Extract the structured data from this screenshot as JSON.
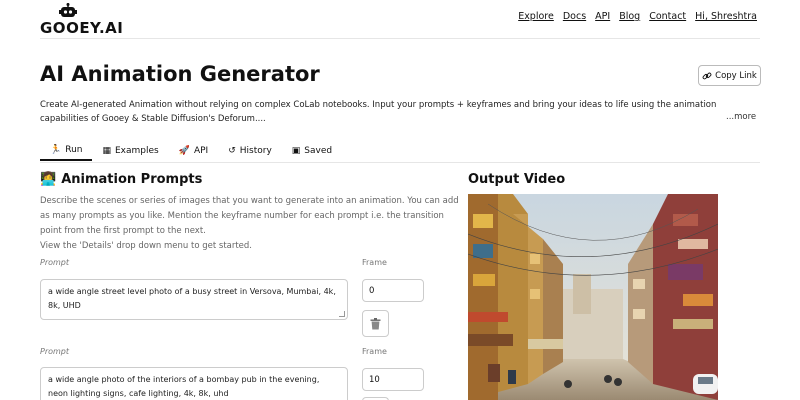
{
  "header": {
    "logo_text": "GOOEY.AI",
    "nav": [
      "Explore",
      "Docs",
      "API",
      "Blog",
      "Contact",
      "Hi, Shreshtra"
    ]
  },
  "page": {
    "title": "AI Animation Generator",
    "copy_link_label": "Copy Link",
    "description": "Create AI-generated Animation without relying on complex CoLab notebooks. Input your prompts + keyframes and bring your ideas to life using the animation capabilities of Gooey & Stable Diffusion's Deforum....",
    "more_label": "...more"
  },
  "tabs": [
    {
      "label": "Run",
      "icon": "run-icon",
      "active": true
    },
    {
      "label": "Examples",
      "icon": "grid-icon",
      "active": false
    },
    {
      "label": "API",
      "icon": "rocket-icon",
      "active": false
    },
    {
      "label": "History",
      "icon": "history-icon",
      "active": false
    },
    {
      "label": "Saved",
      "icon": "saved-icon",
      "active": false
    }
  ],
  "prompts_section": {
    "emoji": "👩‍💻",
    "title": "Animation Prompts",
    "help_lines": [
      "Describe the scenes or series of images that you want to generate into an animation. You can add",
      "as many prompts as you like. Mention the keyframe number for each prompt i.e. the transition",
      "point from the first prompt to the next.",
      "View the 'Details' drop down menu to get started."
    ],
    "prompt_label": "Prompt",
    "frame_label": "Frame",
    "rows": [
      {
        "prompt": "a wide angle street level photo of a busy street in Versova, Mumbai, 4k, 8k, UHD",
        "frame": "0"
      },
      {
        "prompt": "a wide angle photo of the interiors of a bombay pub in the evening, neon lighting signs, cafe lighting, 4k, 8k, uhd",
        "frame": "10"
      }
    ]
  },
  "output": {
    "title": "Output Video"
  },
  "colors": {
    "border": "#cccccc",
    "muted_text": "#666666",
    "accent": "#111111"
  }
}
